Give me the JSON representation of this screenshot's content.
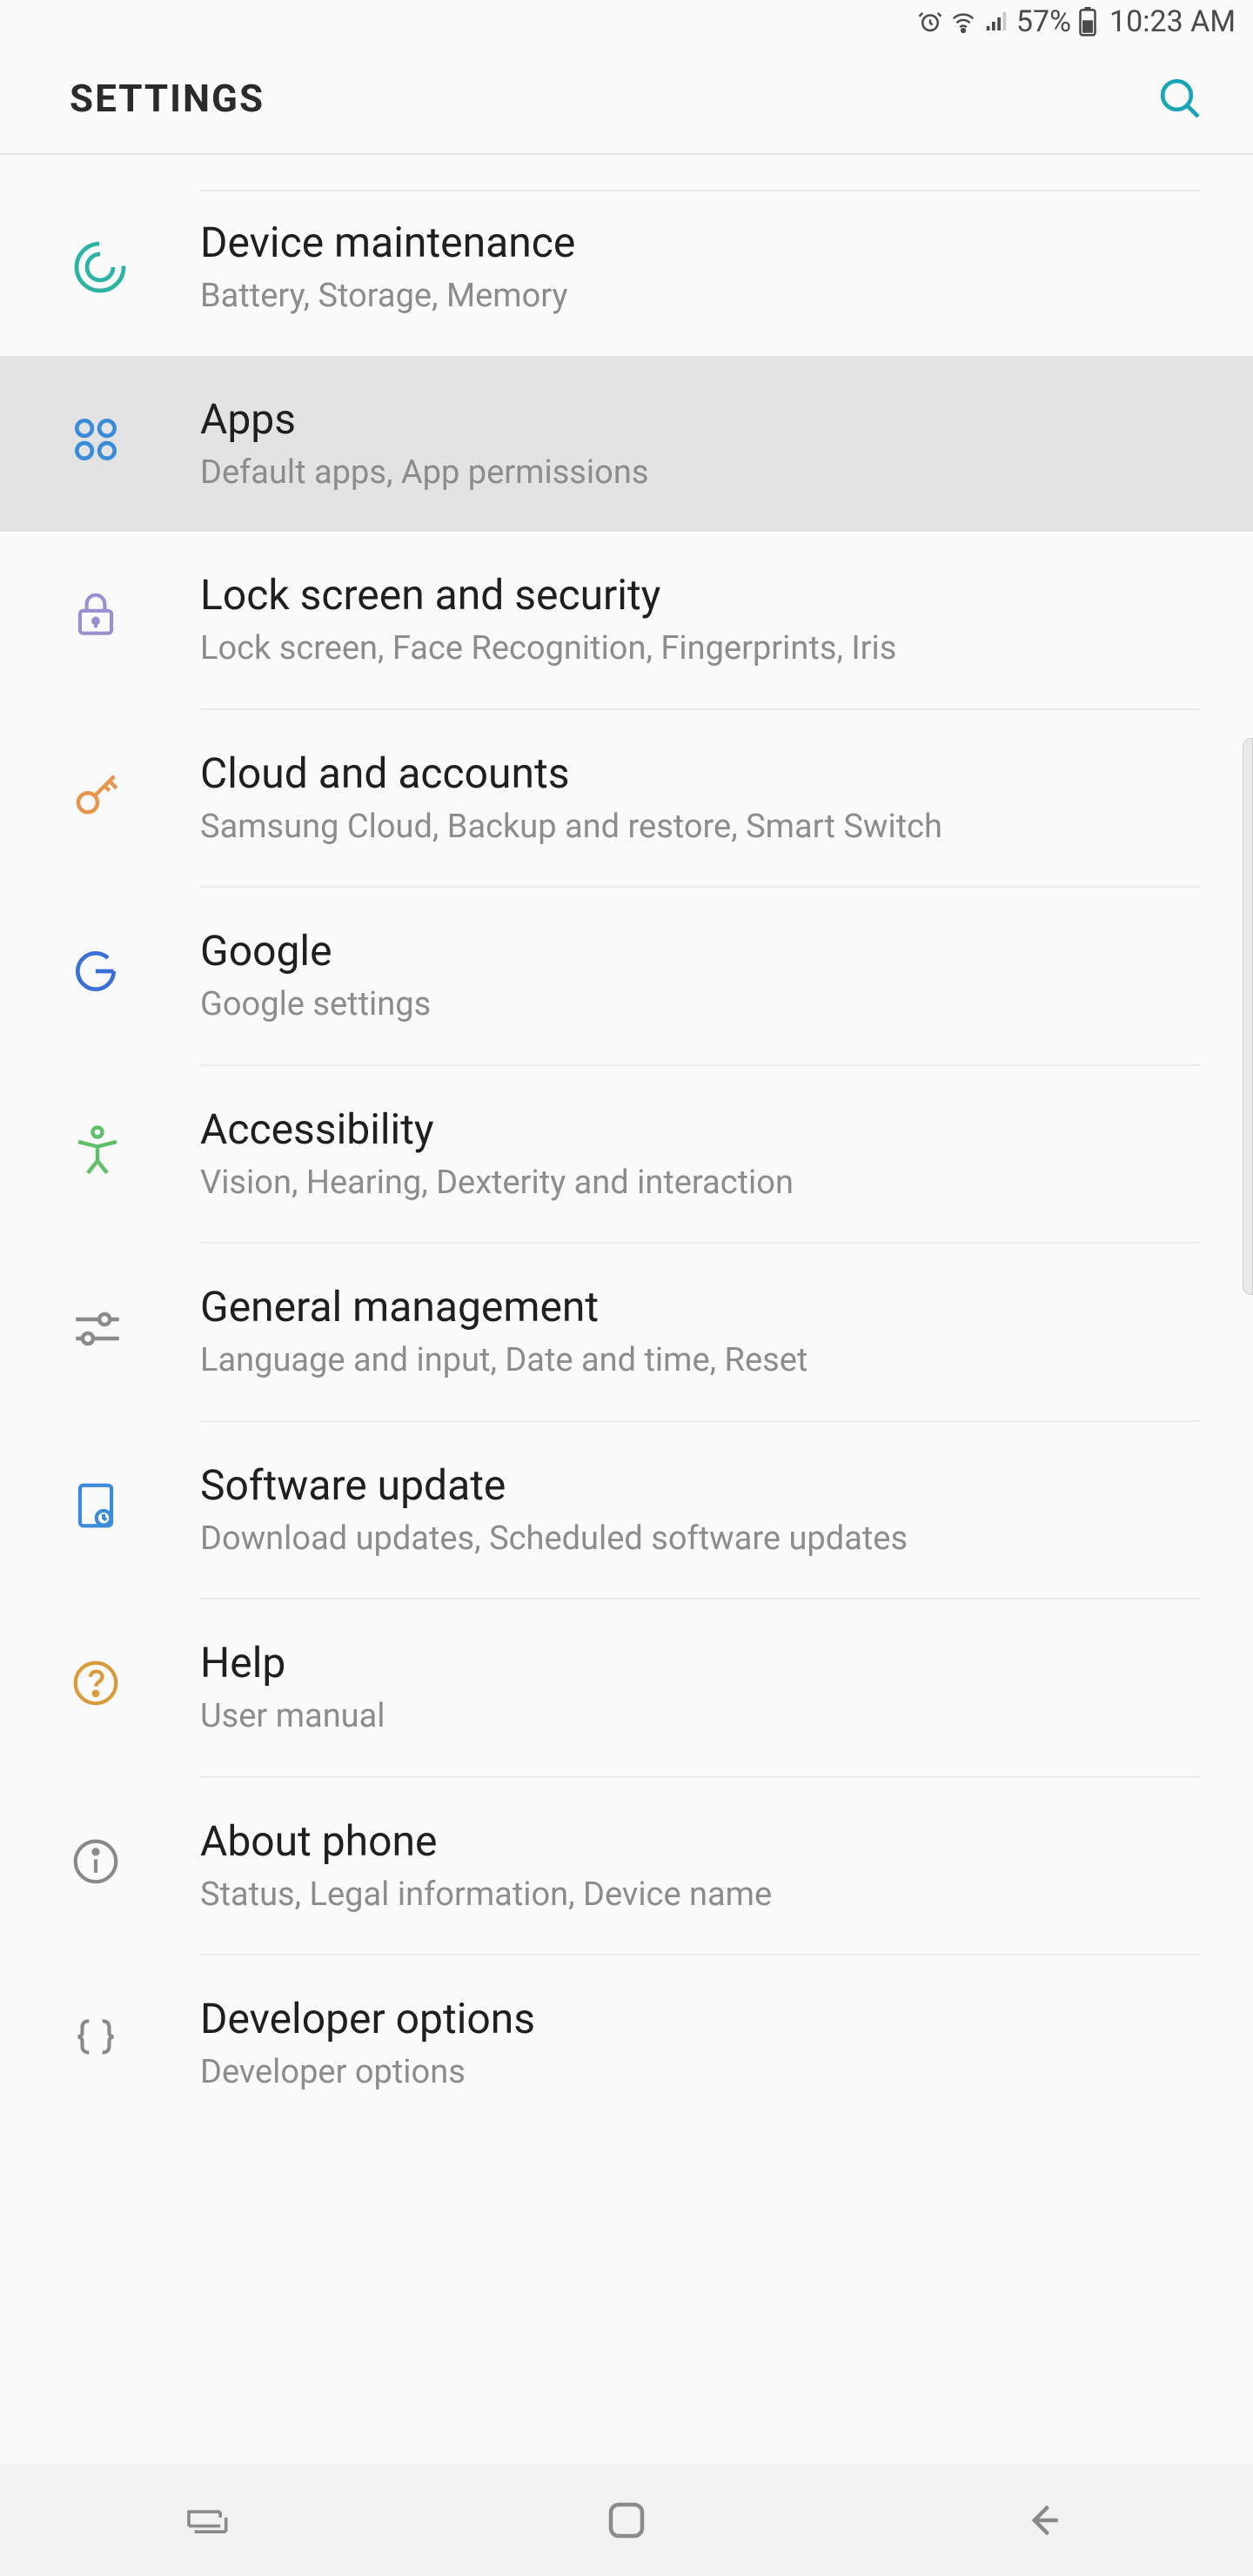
{
  "status": {
    "battery_percent": "57%",
    "time": "10:23 AM"
  },
  "header": {
    "title": "SETTINGS"
  },
  "items": [
    {
      "title": "Device maintenance",
      "subtitle": "Battery, Storage, Memory",
      "selected": false
    },
    {
      "title": "Apps",
      "subtitle": "Default apps, App permissions",
      "selected": true
    },
    {
      "title": "Lock screen and security",
      "subtitle": "Lock screen, Face Recognition, Fingerprints, Iris",
      "selected": false
    },
    {
      "title": "Cloud and accounts",
      "subtitle": "Samsung Cloud, Backup and restore, Smart Switch",
      "selected": false
    },
    {
      "title": "Google",
      "subtitle": "Google settings",
      "selected": false
    },
    {
      "title": "Accessibility",
      "subtitle": "Vision, Hearing, Dexterity and interaction",
      "selected": false
    },
    {
      "title": "General management",
      "subtitle": "Language and input, Date and time, Reset",
      "selected": false
    },
    {
      "title": "Software update",
      "subtitle": "Download updates, Scheduled software updates",
      "selected": false
    },
    {
      "title": "Help",
      "subtitle": "User manual",
      "selected": false
    },
    {
      "title": "About phone",
      "subtitle": "Status, Legal information, Device name",
      "selected": false
    },
    {
      "title": "Developer options",
      "subtitle": "Developer options",
      "selected": false
    }
  ],
  "icons": {
    "device_maintenance": "device-maintenance-icon",
    "apps": "apps-icon",
    "lock": "lock-icon",
    "cloud": "key-icon",
    "google": "google-icon",
    "accessibility": "accessibility-icon",
    "general": "sliders-icon",
    "software": "software-update-icon",
    "help": "help-icon",
    "about": "info-icon",
    "developer": "braces-icon"
  },
  "colors": {
    "teal": "#2bb3a3",
    "blue": "#3a8bd8",
    "violet": "#9b8fd0",
    "orange": "#e8944a",
    "green": "#5fbf6a",
    "grey": "#8a8a8a",
    "amber": "#d99a3a"
  }
}
